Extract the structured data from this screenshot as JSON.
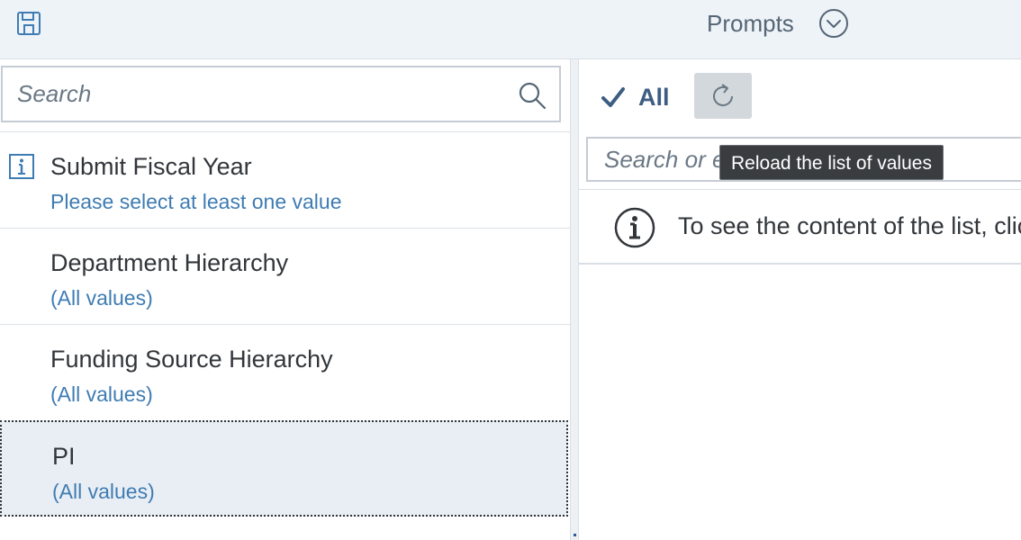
{
  "header": {
    "save_icon": "floppy-disk-icon",
    "title": "Prompts",
    "dropdown_icon": "chevron-down-circle-icon"
  },
  "left_pane": {
    "search": {
      "placeholder": "Search",
      "value": ""
    },
    "prompts": [
      {
        "title": "Submit Fiscal Year",
        "subtitle": "Please select at least one value",
        "icon": "info-icon"
      },
      {
        "title": "Department Hierarchy",
        "subtitle": "(All values)"
      },
      {
        "title": "Funding Source Hierarchy",
        "subtitle": "(All values)"
      },
      {
        "title": "PI",
        "subtitle": "(All values)",
        "selected": true
      }
    ]
  },
  "right_pane": {
    "all_label": "All",
    "reload_icon": "reload-icon",
    "value_search": {
      "placeholder": "Search or enter a value or key"
    },
    "message": "To see the content of the list, click Reload the list of values"
  },
  "tooltip": {
    "text": "Reload the list of values"
  },
  "colors": {
    "header_bg": "#eef3f8",
    "link_blue": "#3f7cb3",
    "selected_bg": "#e9eef4",
    "tooltip_bg": "#3a3d40"
  }
}
